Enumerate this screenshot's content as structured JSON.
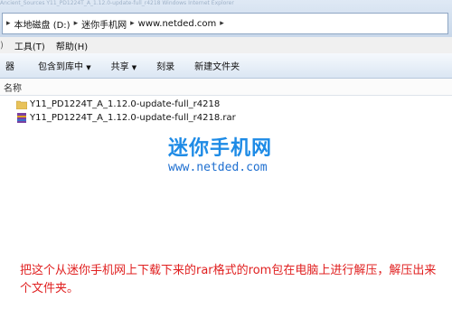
{
  "ghost_text": "Ancient_Sources    Y11_PD1224T_A_1.12.0-update-full_r4218    Windows Internet Explorer",
  "address": {
    "segments": [
      "本地磁盘 (D:)",
      "迷你手机网",
      "www.netded.com"
    ]
  },
  "menu": {
    "tools": "工具(T)",
    "help": "帮助(H)"
  },
  "toolbar": {
    "organize_partial": "器",
    "include_in_library": "包含到库中",
    "share": "共享",
    "burn": "刻录",
    "new_folder": "新建文件夹"
  },
  "columns": {
    "name": "名称"
  },
  "files": [
    {
      "name": "Y11_PD1224T_A_1.12.0-update-full_r4218",
      "type": "folder"
    },
    {
      "name": "Y11_PD1224T_A_1.12.0-update-full_r4218.rar",
      "type": "rar"
    }
  ],
  "watermark": {
    "title": "迷你手机网",
    "url": "www.netded.com"
  },
  "caption": "把这个从迷你手机网上下载下来的rar格式的rom包在电脑上进行解压，解压出来个文件夹。",
  "colors": {
    "brand_blue": "#1e8be6",
    "caption_red": "#e02020"
  }
}
